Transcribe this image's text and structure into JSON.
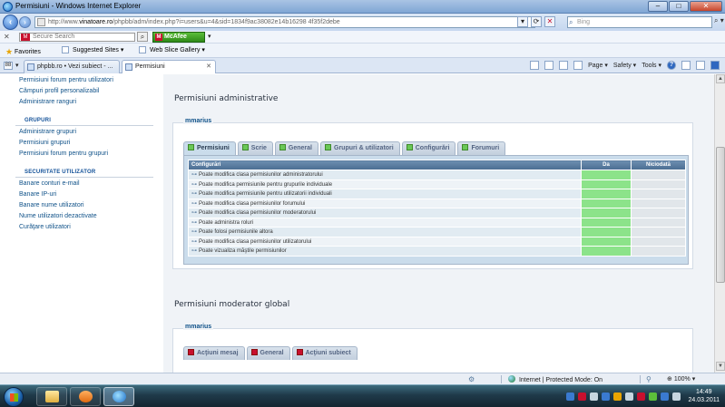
{
  "window": {
    "title": "Permisiuni - Windows Internet Explorer",
    "minimize": "–",
    "maximize": "□",
    "close": "✕"
  },
  "addressbar": {
    "url_prefix": "http://www.",
    "url_host": "vinatoare.ro",
    "url_path": "/phpbb/adm/index.php?i=users&u=4&sid=1834f9ac38082e14b16298 4f35f2debe",
    "search_placeholder": "Bing",
    "search_go": "⌕ ▾"
  },
  "mcafee_toolbar": {
    "close": "✕",
    "search_placeholder": "Secure Search",
    "brand": "McAfee",
    "dropdown": "▾"
  },
  "favorites": {
    "label": "Favorites",
    "items": [
      "Suggested Sites ▾",
      "Web Slice Gallery ▾"
    ]
  },
  "tabs": {
    "grid": "88",
    "dropdown": "▾",
    "items": [
      {
        "label": "phpbb.ro • Vezi subiect - ..."
      },
      {
        "label": "Permisiuni"
      }
    ],
    "close": "✕"
  },
  "commandbar": {
    "page": "Page ▾",
    "safety": "Safety ▾",
    "tools": "Tools ▾",
    "help": "?"
  },
  "sidebar": {
    "top_links": [
      "Permisiuni forum pentru utilizatori",
      "Câmpuri profil personalizabil",
      "Administrare ranguri"
    ],
    "groups_heading": "GRUPURI",
    "groups_links": [
      "Administrare grupuri",
      "Permisiuni grupuri",
      "Permisiuni forum pentru grupuri"
    ],
    "security_heading": "SECURITATE UTILIZATOR",
    "security_links": [
      "Banare conturi e-mail",
      "Banare IP-uri",
      "Banare nume utilizatori",
      "Nume utilizatori dezactivate",
      "Curăţare utilizatori"
    ]
  },
  "admin_perms": {
    "title": "Permisiuni administrative",
    "user": "mmarius",
    "tabs": [
      "Permisiuni",
      "Scrie",
      "General",
      "Grupuri & utilizatori",
      "Configurări",
      "Forumuri"
    ],
    "table": {
      "headers": [
        "Configurări",
        "Da",
        "Niciodată"
      ],
      "rows": [
        "Poate modifica clasa permisiunilor administratorului",
        "Poate modifica permisiunile pentru grupurile individuale",
        "Poate modifica permisiunile pentru utilizatorii individuali",
        "Poate modifica clasa permisiunilor forumului",
        "Poate modifica clasa permisiunilor moderatorului",
        "Poate administra roluri",
        "Poate folosi permisiunile altora",
        "Poate modifica clasa permisiunilor utilizatorului",
        "Poate vizualiza măştile permisiunilor"
      ],
      "yes_color": "#8ce38a"
    }
  },
  "mod_perms": {
    "title": "Permisiuni moderator global",
    "user": "mmarius",
    "tabs": [
      "Acţiuni mesaj",
      "General",
      "Acţiuni subiect"
    ]
  },
  "status": {
    "zone": "Internet | Protected Mode: On",
    "zoom": "100%",
    "zoom_dd": "▾"
  },
  "clock": {
    "time": "14:49",
    "date": "24.03.2011"
  }
}
